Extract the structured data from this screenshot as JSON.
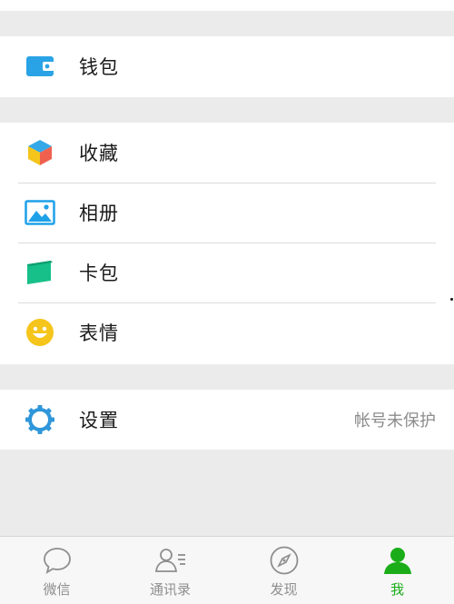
{
  "colors": {
    "accent": "#1aad19",
    "background": "#ebebeb",
    "wallet": "#2aa3e6",
    "album": "#1ea1e8",
    "card": "#17c089",
    "emoji": "#f5c51b",
    "settings": "#2f96d9"
  },
  "wallet_section": {
    "wallet": {
      "label": "钱包",
      "icon": "wallet-icon"
    }
  },
  "features_section": {
    "items": [
      {
        "label": "收藏",
        "icon": "favorites-cube-icon"
      },
      {
        "label": "相册",
        "icon": "album-picture-icon"
      },
      {
        "label": "卡包",
        "icon": "card-package-icon"
      },
      {
        "label": "表情",
        "icon": "smiley-face-icon"
      }
    ]
  },
  "settings_section": {
    "settings": {
      "label": "设置",
      "icon": "gear-icon",
      "detail": "帐号未保护"
    }
  },
  "tabbar": {
    "tabs": [
      {
        "label": "微信",
        "icon": "chat-bubble-icon",
        "active": false
      },
      {
        "label": "通讯录",
        "icon": "contacts-icon",
        "active": false
      },
      {
        "label": "发现",
        "icon": "compass-icon",
        "active": false
      },
      {
        "label": "我",
        "icon": "person-icon",
        "active": true
      }
    ]
  }
}
